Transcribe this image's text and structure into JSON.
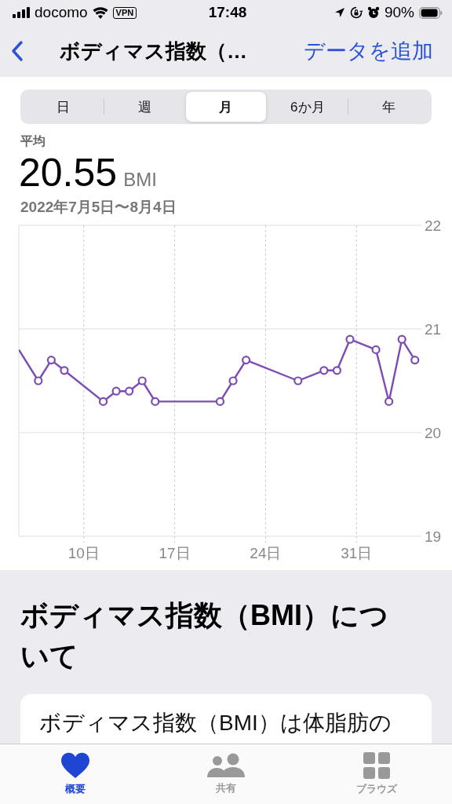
{
  "status_bar": {
    "carrier": "docomo",
    "vpn": "VPN",
    "time": "17:48",
    "battery": "90%"
  },
  "nav": {
    "title": "ボディマス指数（…",
    "action": "データを追加"
  },
  "segments": [
    {
      "label": "日",
      "selected": false
    },
    {
      "label": "週",
      "selected": false
    },
    {
      "label": "月",
      "selected": true
    },
    {
      "label": "6か月",
      "selected": false
    },
    {
      "label": "年",
      "selected": false
    }
  ],
  "summary": {
    "label": "平均",
    "value": "20.55",
    "unit": "BMI",
    "range": "2022年7月5日〜8月4日"
  },
  "chart_data": {
    "type": "line",
    "x": [
      5,
      6.5,
      7.5,
      8.5,
      11.5,
      12.5,
      13.5,
      14.5,
      15.5,
      20.5,
      21.5,
      22.5,
      26.5,
      28.5,
      29.5,
      30.5,
      32.5,
      33.5,
      34.5,
      35.5
    ],
    "series": [
      {
        "color": "#7d4cb5",
        "marker": "circle",
        "values": [
          20.8,
          20.5,
          20.7,
          20.6,
          20.3,
          20.4,
          20.4,
          20.5,
          20.3,
          20.3,
          20.5,
          20.7,
          20.5,
          20.6,
          20.6,
          20.9,
          20.8,
          20.3,
          20.9,
          20.7
        ]
      }
    ],
    "xlim": [
      5,
      36
    ],
    "ylim": [
      19,
      22
    ],
    "xticks": [
      {
        "value": 10,
        "label": "10日"
      },
      {
        "value": 17,
        "label": "17日"
      },
      {
        "value": 24,
        "label": "24日"
      },
      {
        "value": 31,
        "label": "31日"
      }
    ],
    "yticks": [
      19,
      20,
      21,
      22
    ],
    "grid": true
  },
  "about": {
    "heading": "ボディマス指数（BMI）について",
    "text": "ボディマス指数（BMI）は体脂肪の"
  },
  "tab_bar": [
    {
      "kind": "heart",
      "label": "概要",
      "selected": true
    },
    {
      "kind": "people",
      "label": "共有",
      "selected": false
    },
    {
      "kind": "grid",
      "label": "ブラウズ",
      "selected": false
    }
  ]
}
